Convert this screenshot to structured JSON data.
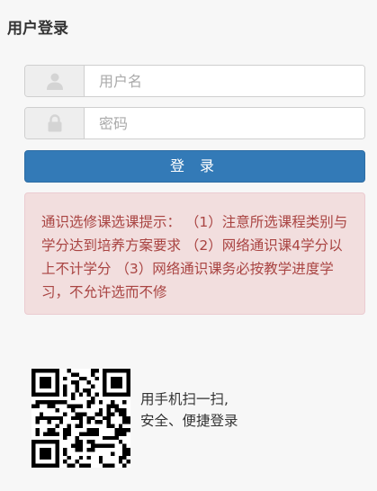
{
  "page": {
    "title": "用户登录"
  },
  "login": {
    "username_placeholder": "用户名",
    "password_placeholder": "密码",
    "submit_label": "登 录",
    "user_icon": "user-icon",
    "lock_icon": "lock-icon"
  },
  "notice": {
    "text": "通识选修课选课提示： （1）注意所选课程类别与学分达到培养方案要求 （2）网络通识课4学分以上不计学分 （3）网络通识课务必按教学进度学习，不允许选而不修"
  },
  "qr": {
    "line1": "用手机扫一扫,",
    "line2": "安全、便捷登录"
  },
  "colors": {
    "primary": "#337ab7",
    "alert_bg": "#f2dede",
    "alert_text": "#a94442",
    "alert_border": "#ebccd1"
  }
}
